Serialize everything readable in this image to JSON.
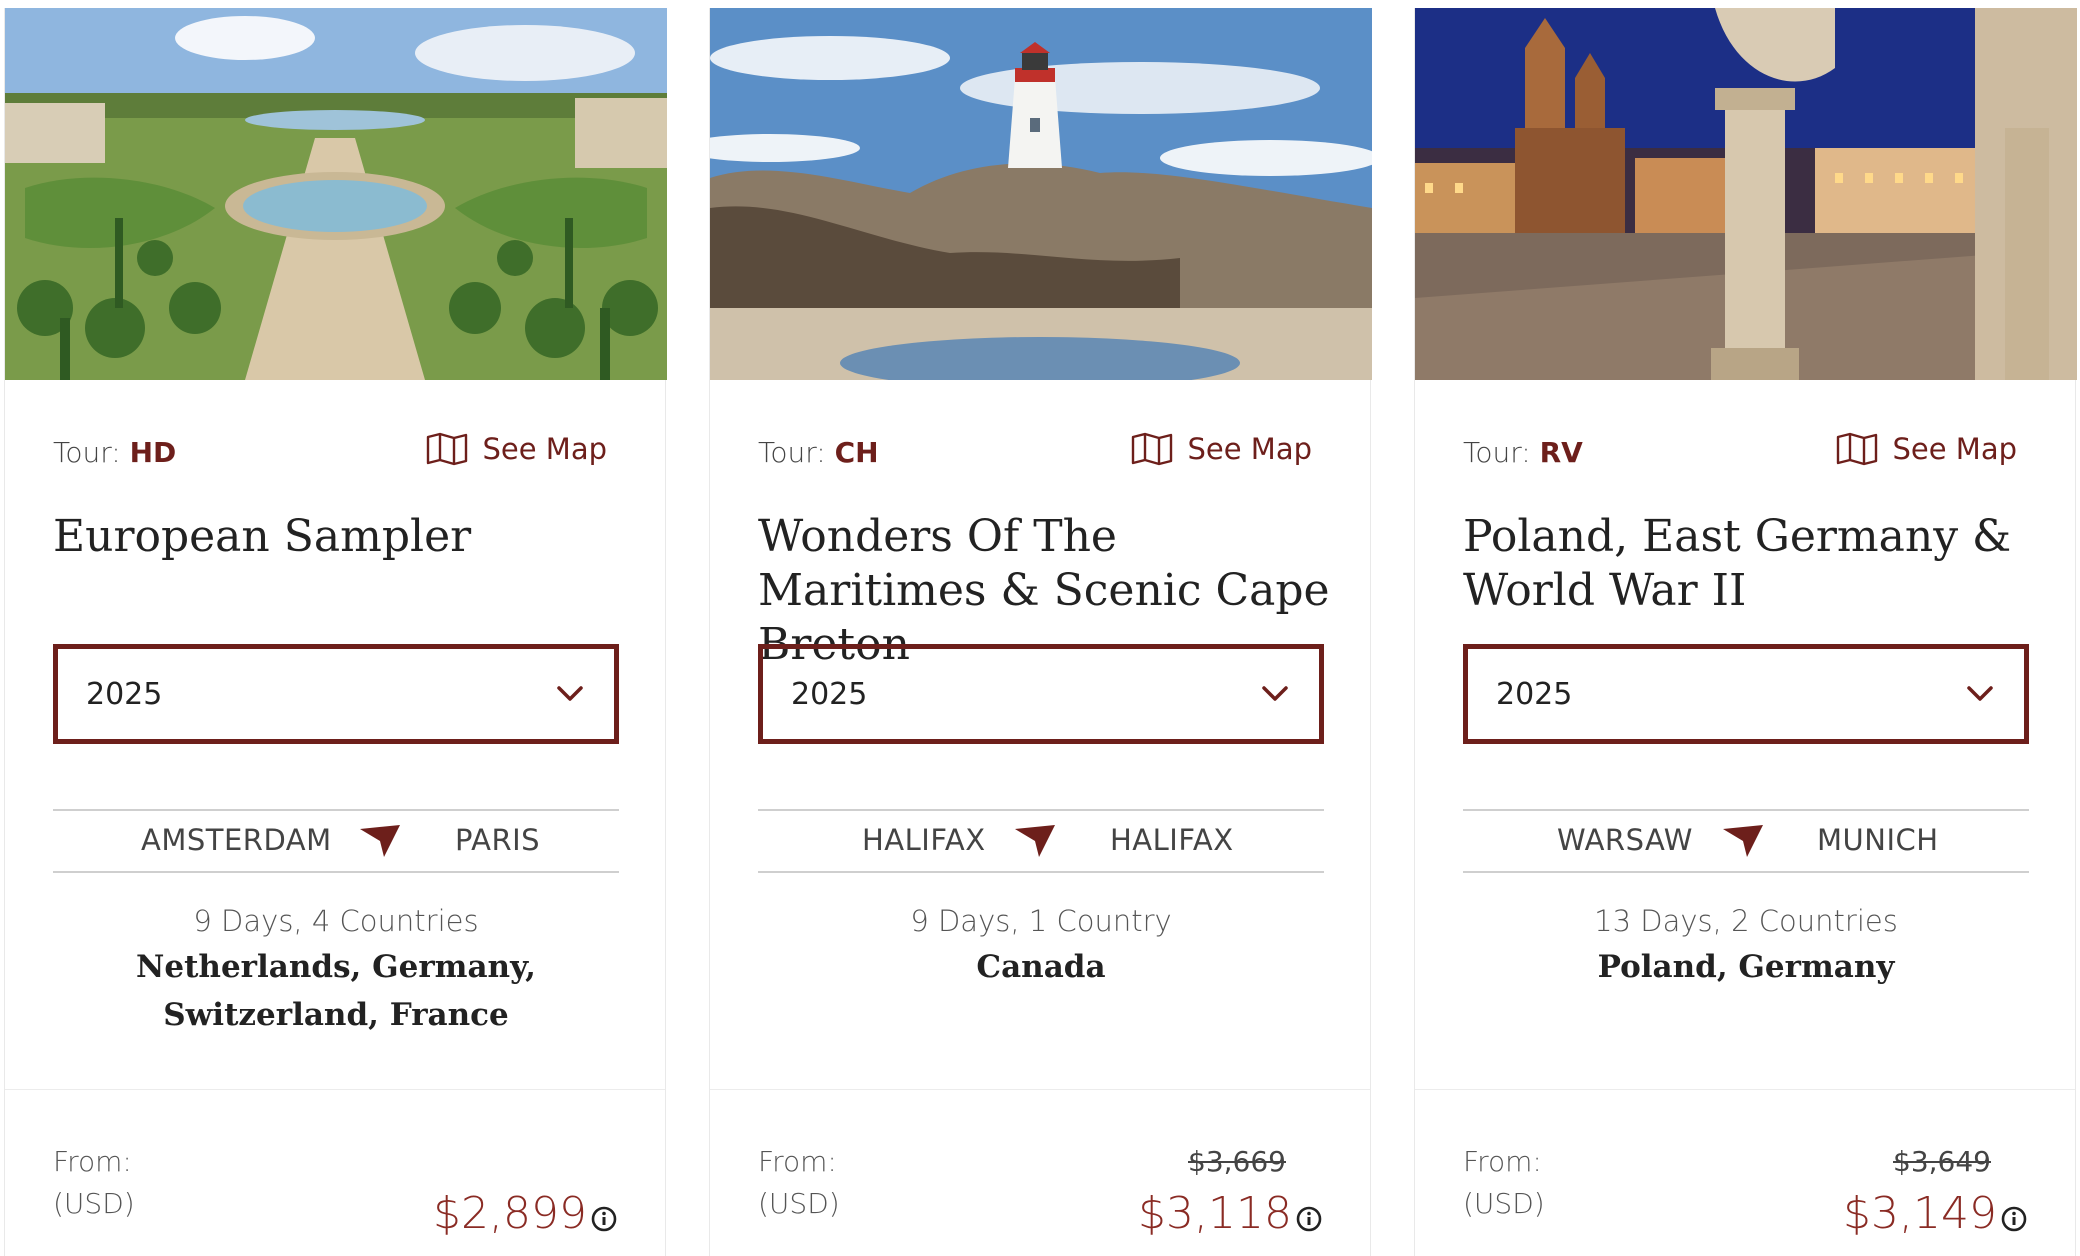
{
  "accent_color": "#6d1f1b",
  "cards": [
    {
      "image": "versailles-orangerie-gardens",
      "tour_prefix": "Tour:",
      "tour_code": "HD",
      "see_map": "See Map",
      "title": "European Sampler",
      "year": "2025",
      "route_from": "AMSTERDAM",
      "route_to": "PARIS",
      "duration": "9 Days, 4 Countries",
      "countries": "Netherlands, Germany, Switzerland, France",
      "from_label": "From:",
      "currency_label": "(USD)",
      "old_price": "",
      "price": "$2,899"
    },
    {
      "image": "peggys-cove-lighthouse",
      "tour_prefix": "Tour:",
      "tour_code": "CH",
      "see_map": "See Map",
      "title": "Wonders Of The Maritimes & Scenic Cape Breton",
      "year": "2025",
      "route_from": "HALIFAX",
      "route_to": "HALIFAX",
      "duration": "9 Days, 1 Country",
      "countries": "Canada",
      "from_label": "From:",
      "currency_label": "(USD)",
      "old_price": "$3,669",
      "price": "$3,118"
    },
    {
      "image": "krakow-market-square",
      "tour_prefix": "Tour:",
      "tour_code": "RV",
      "see_map": "See Map",
      "title": "Poland, East Germany & World War II",
      "year": "2025",
      "route_from": "WARSAW",
      "route_to": "MUNICH",
      "duration": "13 Days, 2 Countries",
      "countries": "Poland, Germany",
      "from_label": "From:",
      "currency_label": "(USD)",
      "old_price": "$3,649",
      "price": "$3,149"
    }
  ]
}
